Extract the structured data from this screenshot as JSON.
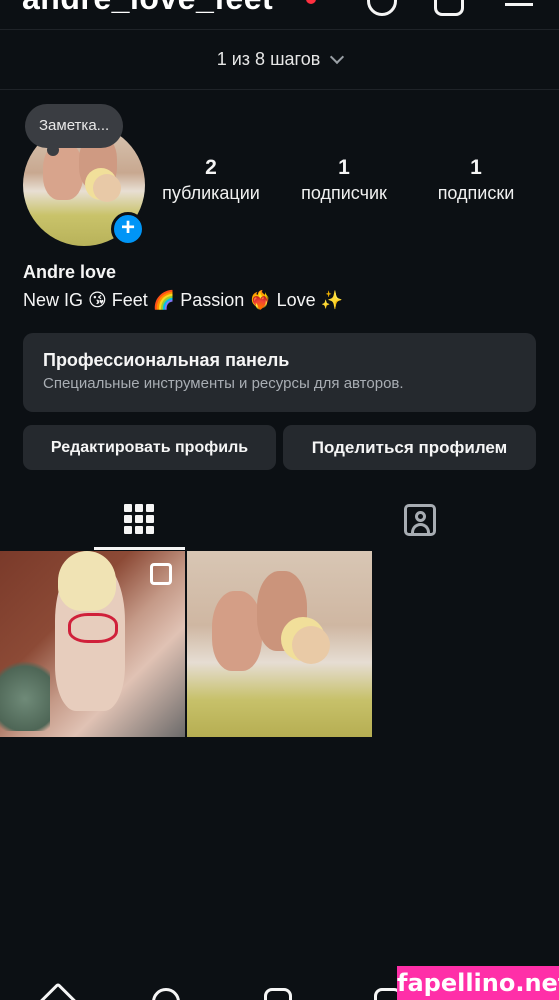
{
  "header": {
    "username": "andre_love_feet"
  },
  "steps": {
    "label": "1 из 8 шагов"
  },
  "profile": {
    "note_bubble": "Заметка...",
    "stats": {
      "posts_count": "2",
      "posts_label": "публикации",
      "followers_count": "1",
      "followers_label": "подписчик",
      "following_count": "1",
      "following_label": "подписки"
    },
    "display_name": "Andre love",
    "bio": "New IG 😘 Feet 🌈 Passion ❤️‍🔥 Love ✨"
  },
  "pro_panel": {
    "title": "Профессиональная панель",
    "subtitle": "Специальные инструменты и ресурсы для авторов."
  },
  "actions": {
    "edit_profile": "Редактировать профиль",
    "share_profile": "Поделиться профилем"
  },
  "tabs": [
    {
      "icon": "grid-icon",
      "active": true
    },
    {
      "icon": "tagged-icon",
      "active": false
    }
  ],
  "posts": [
    {
      "multi_image": true
    },
    {
      "multi_image": false
    }
  ],
  "watermark": "fapellino.net",
  "colors": {
    "background": "#0c1014",
    "surface": "#25292e",
    "accent_blue": "#0095f6",
    "watermark_pink": "#ff2fa8"
  }
}
